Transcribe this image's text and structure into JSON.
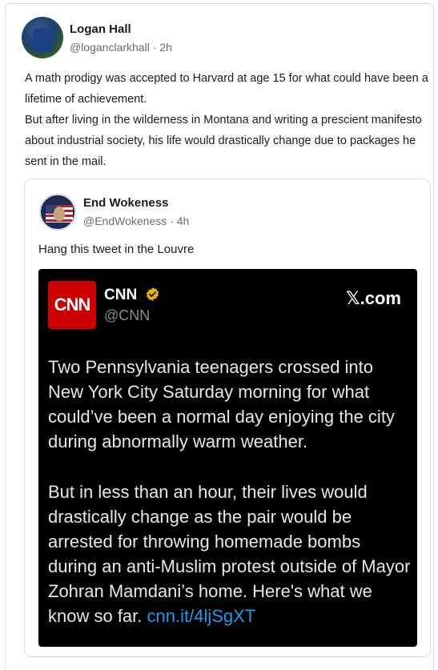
{
  "post": {
    "author_name": "Logan Hall",
    "handle": "@loganclarkhall",
    "separator": "·",
    "time": "2h",
    "paragraph1": "A math prodigy was accepted to Harvard at age 15 for what could have been a lifetime of achievement.",
    "paragraph2": "But after living in the wilderness in Montana and writing a prescient manifesto about industrial society, his life would drastically change due to packages he sent in the mail."
  },
  "quoted": {
    "author_name": "End Wokeness",
    "handle": "@EndWokeness",
    "separator": "·",
    "time": "4h",
    "text": "Hang this tweet in the Louvre",
    "embed": {
      "logo_text": "CNN",
      "name": "CNN",
      "handle": "@CNN",
      "site": "𝕏.com",
      "paragraph1": "Two Pennsylvania teenagers crossed into New York City Saturday morning for what could’ve been a normal day enjoying the city during abnormally warm weather.",
      "paragraph2_text": "But in less than an hour, their lives would drastically change as the pair would be arrested for throwing homemade bombs during an anti-Muslim protest outside of Mayor Zohran Mamdani’s home. Here's what we know so far.",
      "paragraph2_link": "cnn.it/4ljSgXT"
    }
  },
  "colors": {
    "cnn_red": "#cc0000",
    "link_blue": "#1d9bf0",
    "verified_gold": "#e8b400"
  }
}
